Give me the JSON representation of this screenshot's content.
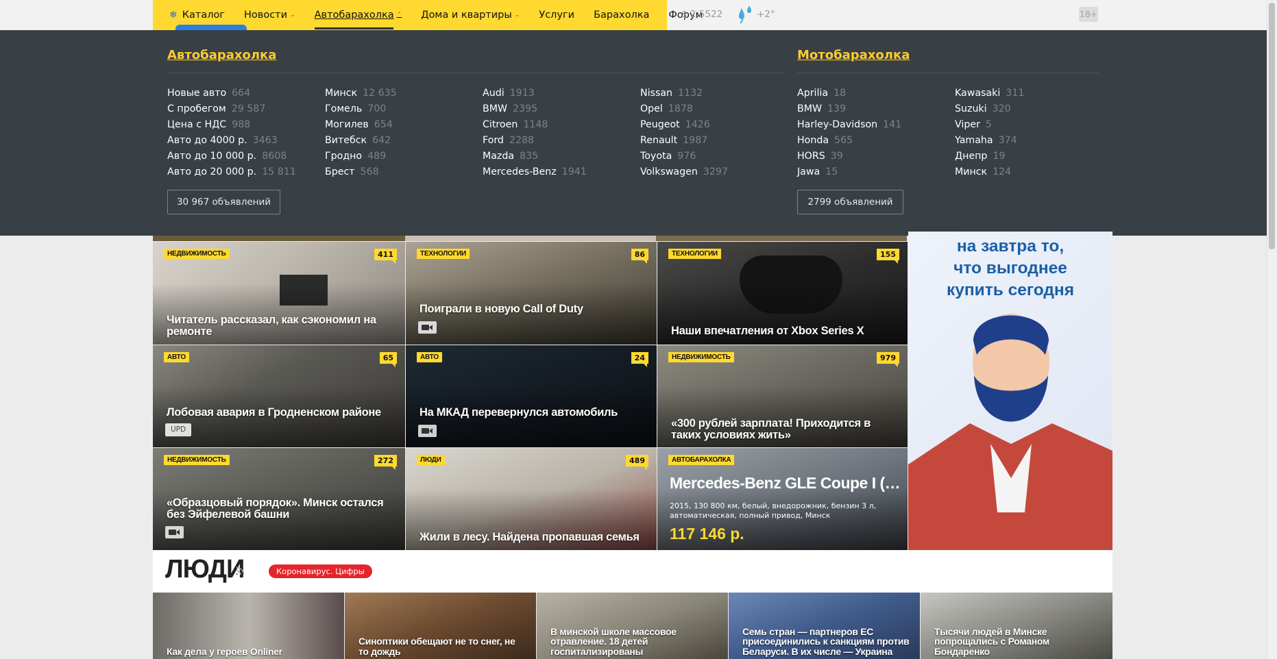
{
  "nav": {
    "catalog": "Каталог",
    "items": [
      {
        "label": "Новости",
        "chevron": true,
        "active": false
      },
      {
        "label": "Автобарахолка",
        "chevron": true,
        "active": true
      },
      {
        "label": "Дома и квартиры",
        "chevron": true,
        "active": false
      },
      {
        "label": "Услуги",
        "chevron": false,
        "active": false
      },
      {
        "label": "Барахолка",
        "chevron": false,
        "active": false
      },
      {
        "label": "Форум",
        "chevron": false,
        "active": false
      }
    ],
    "rate": "$ 2,5522",
    "temp": "+2°",
    "age": "18+"
  },
  "auto": {
    "title": "Автобарахолка",
    "col1": [
      [
        "Новые авто",
        "664"
      ],
      [
        "С пробегом",
        "29 587"
      ],
      [
        "Цена с НДС",
        "988"
      ],
      [
        "Авто до 4000 р.",
        "3463"
      ],
      [
        "Авто до 10 000 р.",
        "8608"
      ],
      [
        "Авто до 20 000 р.",
        "15 811"
      ]
    ],
    "col2": [
      [
        "Минск",
        "12 635"
      ],
      [
        "Гомель",
        "700"
      ],
      [
        "Могилев",
        "654"
      ],
      [
        "Витебск",
        "642"
      ],
      [
        "Гродно",
        "489"
      ],
      [
        "Брест",
        "568"
      ]
    ],
    "col3": [
      [
        "Audi",
        "1913"
      ],
      [
        "BMW",
        "2395"
      ],
      [
        "Citroen",
        "1148"
      ],
      [
        "Ford",
        "2288"
      ],
      [
        "Mazda",
        "835"
      ],
      [
        "Mercedes-Benz",
        "1941"
      ]
    ],
    "col4": [
      [
        "Nissan",
        "1132"
      ],
      [
        "Opel",
        "1878"
      ],
      [
        "Peugeot",
        "1426"
      ],
      [
        "Renault",
        "1987"
      ],
      [
        "Toyota",
        "976"
      ],
      [
        "Volkswagen",
        "3297"
      ]
    ],
    "button": "30 967 объявлений"
  },
  "moto": {
    "title": "Мотобарахолка",
    "col1": [
      [
        "Aprilia",
        "18"
      ],
      [
        "BMW",
        "139"
      ],
      [
        "Harley-Davidson",
        "141"
      ],
      [
        "Honda",
        "565"
      ],
      [
        "HORS",
        "39"
      ],
      [
        "Jawa",
        "15"
      ]
    ],
    "col2": [
      [
        "Kawasaki",
        "311"
      ],
      [
        "Suzuki",
        "320"
      ],
      [
        "Viper",
        "5"
      ],
      [
        "Yamaha",
        "374"
      ],
      [
        "Днепр",
        "19"
      ],
      [
        "Минск",
        "124"
      ]
    ],
    "button": "2799 объявлений"
  },
  "tiles": [
    {
      "rubric": "НЕДВИЖИМОСТЬ",
      "count": "411",
      "title": "Читатель рассказал, как сэкономил на ремонте"
    },
    {
      "rubric": "ТЕХНОЛОГИИ",
      "count": "86",
      "title": "Поиграли в новую Call of Duty"
    },
    {
      "rubric": "ТЕХНОЛОГИИ",
      "count": "155",
      "title": "Наши впечатления от Xbox Series X"
    },
    {
      "rubric": "АВТО",
      "count": "65",
      "title": "Лобовая авария в Гродненском районе",
      "badge": "UPD"
    },
    {
      "rubric": "АВТО",
      "count": "24",
      "title": "На МКАД перевернулся автомобиль"
    },
    {
      "rubric": "НЕДВИЖИМОСТЬ",
      "count": "979",
      "title": "«300 рублей зарплата! Приходится в таких условиях жить»"
    },
    {
      "rubric": "НЕДВИЖИМОСТЬ",
      "count": "272",
      "title": "«Образцовый порядок». Минск остался без Эйфелевой башни"
    },
    {
      "rubric": "ЛЮДИ",
      "count": "489",
      "title": "Жили в лесу. Найдена пропавшая семья"
    },
    {
      "rubric": "АВТОБАРАХОЛКА",
      "title": "Mercedes-Benz GLE Coupe I (…",
      "details": "2015, 130 800 км, белый, внедорожник, бензин 3 л, автоматическая, полный привод, Минск",
      "price": "117 146 р."
    }
  ],
  "ad": {
    "lines": [
      "на завтра то,",
      "что выгоднее",
      "купить сегодня"
    ]
  },
  "people": {
    "title": "ЛЮДИ",
    "tag": "Коронавирус. Цифры",
    "items": [
      "Как дела у героев Onliner",
      "Синоптики обещают не то снег, не то дождь",
      "В минской школе массовое отравление. 18 детей госпитализированы",
      "Семь стран — партнеров ЕС присоединились к санкциям против Беларуси. В их числе — Украина",
      "Тысячи людей в Минске попрощались с Романом Бондаренко"
    ]
  },
  "colors": {
    "brand_yellow": "#ffd92f",
    "menu_bg": "#383f45",
    "link_yellow": "#ffcc2f",
    "alert_red": "#e4252c"
  }
}
